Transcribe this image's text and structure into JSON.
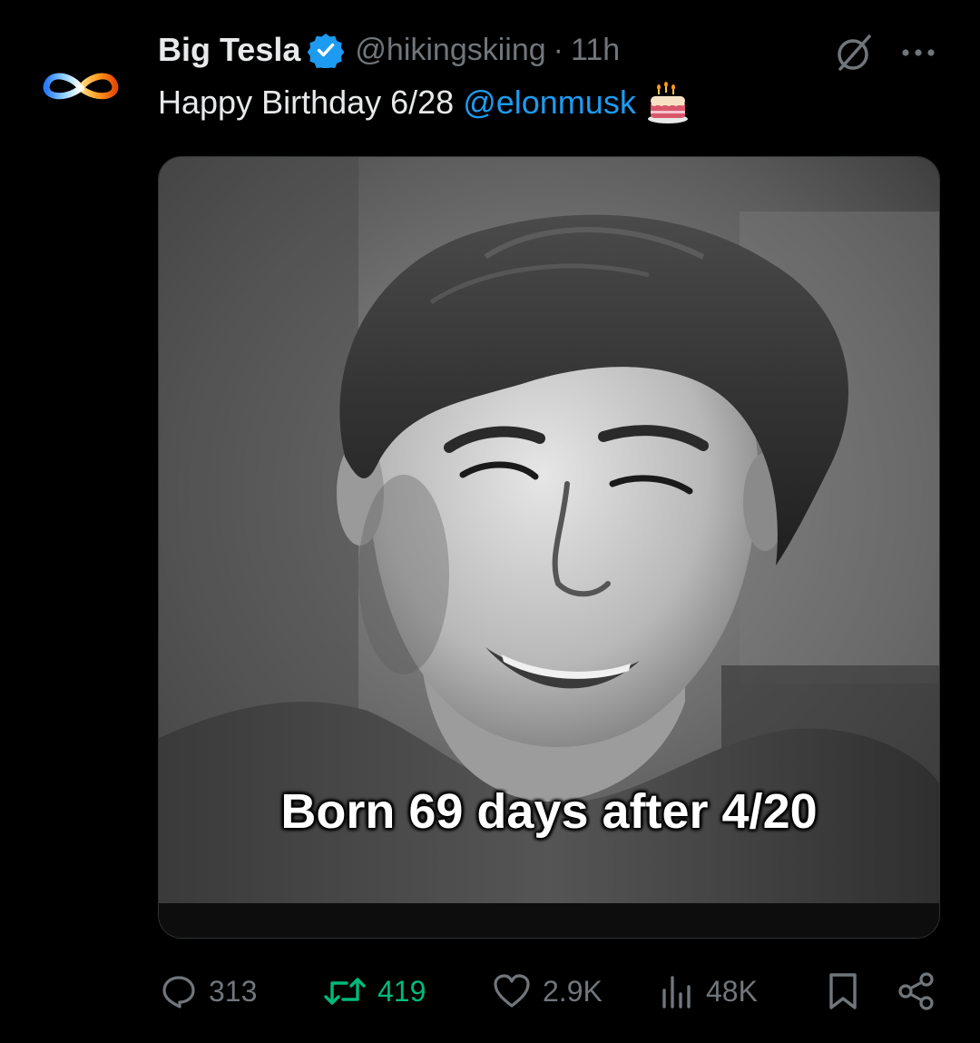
{
  "tweet": {
    "display_name": "Big Tesla",
    "handle": "@hikingskiing",
    "separator": "·",
    "time": "11h",
    "text": "Happy Birthday 6/28",
    "mention": "@elonmusk",
    "image_caption": "Born 69 days after 4/20"
  },
  "icons": {
    "verified": "verified-badge-icon",
    "grok": "grok-icon",
    "more": "more-options-icon",
    "cake": "birthday-cake-emoji",
    "reply": "reply-icon",
    "retweet": "retweet-icon",
    "like": "heart-icon",
    "views": "views-icon",
    "bookmark": "bookmark-icon",
    "share": "share-icon"
  },
  "actions": {
    "replies": "313",
    "retweets": "419",
    "likes": "2.9K",
    "views": "48K"
  },
  "colors": {
    "background": "#000000",
    "text": "#e7e9ea",
    "muted": "#71767b",
    "accent": "#1d9bf0",
    "retweet_active": "#00ba7c"
  }
}
